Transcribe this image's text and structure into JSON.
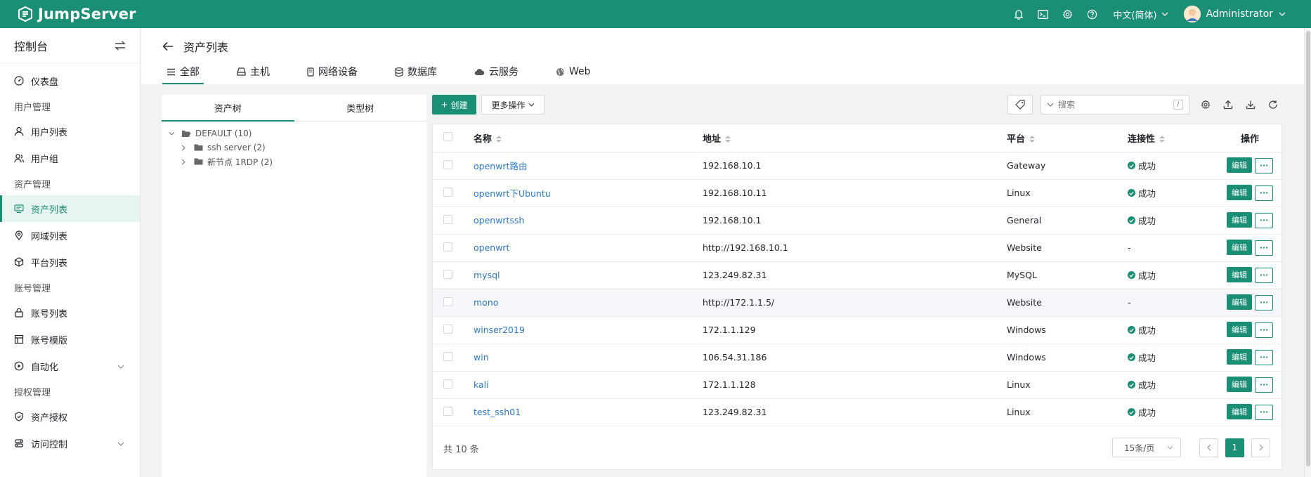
{
  "app": {
    "name": "JumpServer"
  },
  "topbar": {
    "language": "中文(简体)",
    "username": "Administrator",
    "icons": [
      "bell-icon",
      "terminal-icon",
      "gear-icon",
      "help-icon"
    ]
  },
  "sidebar": {
    "title": "控制台",
    "items": [
      {
        "type": "item",
        "label": "仪表盘",
        "icon": "dashboard-icon"
      },
      {
        "type": "group",
        "label": "用户管理"
      },
      {
        "type": "item",
        "label": "用户列表",
        "icon": "user-icon"
      },
      {
        "type": "item",
        "label": "用户组",
        "icon": "user-group-icon"
      },
      {
        "type": "group",
        "label": "资产管理"
      },
      {
        "type": "item",
        "label": "资产列表",
        "icon": "asset-list-icon",
        "active": true
      },
      {
        "type": "item",
        "label": "网域列表",
        "icon": "location-icon"
      },
      {
        "type": "item",
        "label": "平台列表",
        "icon": "cube-icon"
      },
      {
        "type": "group",
        "label": "账号管理"
      },
      {
        "type": "item",
        "label": "账号列表",
        "icon": "lock-icon"
      },
      {
        "type": "item",
        "label": "账号模版",
        "icon": "template-icon"
      },
      {
        "type": "item",
        "label": "自动化",
        "icon": "automation-icon",
        "expandable": true
      },
      {
        "type": "group",
        "label": "授权管理"
      },
      {
        "type": "item",
        "label": "资产授权",
        "icon": "shield-icon"
      },
      {
        "type": "item",
        "label": "访问控制",
        "icon": "access-control-icon",
        "expandable": true
      }
    ]
  },
  "page": {
    "title": "资产列表"
  },
  "tabs": [
    {
      "label": "全部",
      "icon": "list-icon",
      "active": true
    },
    {
      "label": "主机",
      "icon": "host-icon"
    },
    {
      "label": "网络设备",
      "icon": "network-device-icon"
    },
    {
      "label": "数据库",
      "icon": "database-icon"
    },
    {
      "label": "云服务",
      "icon": "cloud-icon"
    },
    {
      "label": "Web",
      "icon": "globe-icon"
    }
  ],
  "tree": {
    "tabs": [
      "资产树",
      "类型树"
    ],
    "nodes": [
      {
        "label": "DEFAULT (10)",
        "level": 0,
        "expanded": true
      },
      {
        "label": "ssh server (2)",
        "level": 1
      },
      {
        "label": "新节点 1RDP (2)",
        "level": 1
      }
    ]
  },
  "toolbar": {
    "create_label": "创建",
    "more_label": "更多操作",
    "search_placeholder": "搜索",
    "search_shortcut": "/"
  },
  "table": {
    "columns": [
      "名称",
      "地址",
      "平台",
      "连接性",
      "操作"
    ],
    "edit_label": "编辑",
    "more_label": "···",
    "rows": [
      {
        "name": "openwrt路由",
        "address": "192.168.10.1",
        "platform": "Gateway",
        "connectivity": "成功",
        "ok": true
      },
      {
        "name": "openwrt下Ubuntu",
        "address": "192.168.10.11",
        "platform": "Linux",
        "connectivity": "成功",
        "ok": true
      },
      {
        "name": "openwrtssh",
        "address": "192.168.10.1",
        "platform": "General",
        "connectivity": "成功",
        "ok": true
      },
      {
        "name": "openwrt",
        "address": "http://192.168.10.1",
        "platform": "Website",
        "connectivity": "-",
        "ok": false
      },
      {
        "name": "mysql",
        "address": "123.249.82.31",
        "platform": "MySQL",
        "connectivity": "成功",
        "ok": true
      },
      {
        "name": "mono",
        "address": "http://172.1.1.5/",
        "platform": "Website",
        "connectivity": "-",
        "ok": false,
        "highlight": true
      },
      {
        "name": "winser2019",
        "address": "172.1.1.129",
        "platform": "Windows",
        "connectivity": "成功",
        "ok": true
      },
      {
        "name": "win",
        "address": "106.54.31.186",
        "platform": "Windows",
        "connectivity": "成功",
        "ok": true
      },
      {
        "name": "kali",
        "address": "172.1.1.128",
        "platform": "Linux",
        "connectivity": "成功",
        "ok": true
      },
      {
        "name": "test_ssh01",
        "address": "123.249.82.31",
        "platform": "Linux",
        "connectivity": "成功",
        "ok": true
      }
    ]
  },
  "footer": {
    "total": "共 10 条",
    "page_size": "15条/页",
    "current_page": "1"
  },
  "colors": {
    "brand": "#1b8f75",
    "link": "#2f78c2"
  }
}
